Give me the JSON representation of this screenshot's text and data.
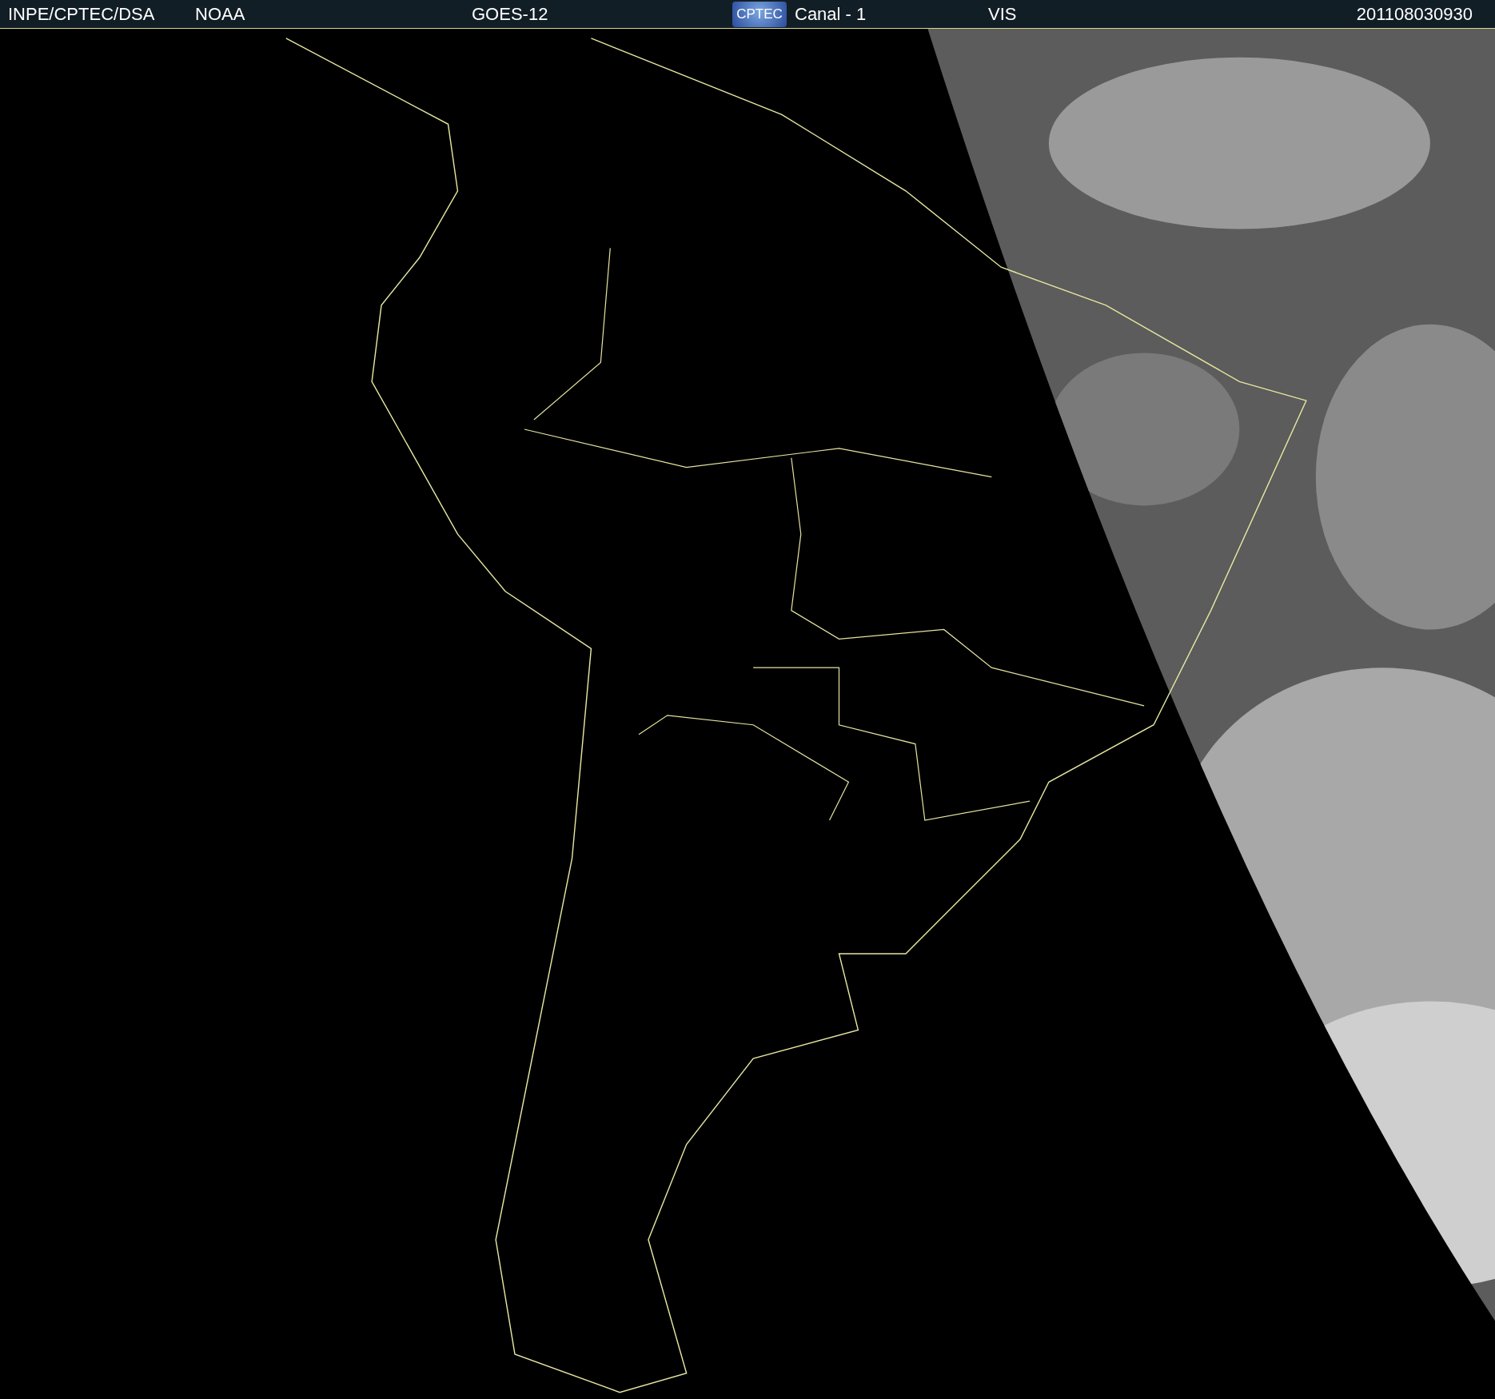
{
  "header": {
    "source": "INPE/CPTEC/DSA",
    "agency": "NOAA",
    "satellite": "GOES-12",
    "logo_text": "CPTEC",
    "channel": "Canal - 1",
    "band": "VIS",
    "timestamp": "201108030930"
  }
}
